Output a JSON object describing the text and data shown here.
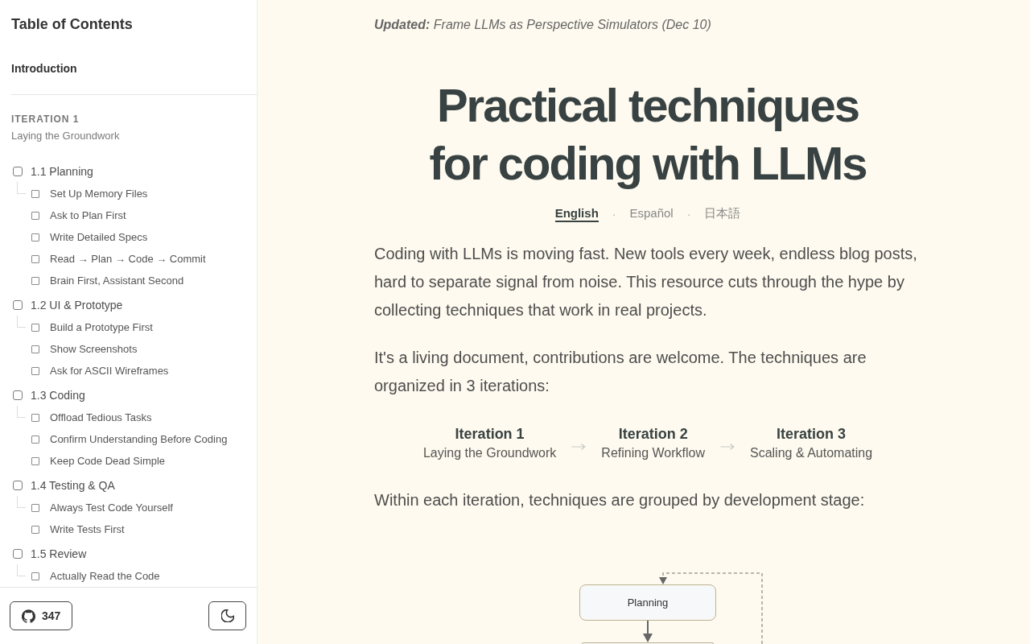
{
  "sidebar": {
    "title": "Table of Contents",
    "intro": {
      "label": "Introduction"
    },
    "iterations": [
      {
        "heading": "ITERATION 1",
        "subtitle": "Laying the Groundwork",
        "sections": [
          {
            "label": "1.1 Planning",
            "checked": false,
            "children": [
              {
                "label": "Set Up Memory Files",
                "checked": false
              },
              {
                "label": "Ask to Plan First",
                "checked": false
              },
              {
                "label": "Write Detailed Specs",
                "checked": false
              },
              {
                "label": "Read → Plan → Code → Commit",
                "checked": false
              },
              {
                "label": "Brain First, Assistant Second",
                "checked": false
              }
            ]
          },
          {
            "label": "1.2 UI & Prototype",
            "checked": false,
            "children": [
              {
                "label": "Build a Prototype First",
                "checked": false
              },
              {
                "label": "Show Screenshots",
                "checked": false
              },
              {
                "label": "Ask for ASCII Wireframes",
                "checked": false
              }
            ]
          },
          {
            "label": "1.3 Coding",
            "checked": false,
            "children": [
              {
                "label": "Offload Tedious Tasks",
                "checked": false
              },
              {
                "label": "Confirm Understanding Before Coding",
                "checked": false
              },
              {
                "label": "Keep Code Dead Simple",
                "checked": false
              }
            ]
          },
          {
            "label": "1.4 Testing & QA",
            "checked": false,
            "children": [
              {
                "label": "Always Test Code Yourself",
                "checked": false
              },
              {
                "label": "Write Tests First",
                "checked": false
              }
            ]
          },
          {
            "label": "1.5 Review",
            "checked": false,
            "children": [
              {
                "label": "Actually Read the Code",
                "checked": false
              }
            ]
          }
        ]
      }
    ],
    "footer": {
      "github_stars": "347"
    }
  },
  "main": {
    "updated": "**Updated:** Frame LLMs as Perspective Simulators (Dec 10)",
    "title_lines": [
      "Practical techniques",
      "for coding with LLMs"
    ],
    "languages": [
      {
        "kind": "link",
        "label": "English",
        "selected": true
      },
      {
        "kind": "separator",
        "label": "·"
      },
      {
        "kind": "link",
        "label": "Español",
        "selected": false
      },
      {
        "kind": "separator",
        "label": "·"
      },
      {
        "kind": "link",
        "label": "日本語",
        "selected": false
      }
    ],
    "paragraphs_before": [
      "Coding with LLMs is moving fast. New tools every week, endless blog posts, hard to separate signal from noise. This resource cuts through the hype by collecting techniques that work in real projects.",
      "It's a living document, contributions are welcome. The techniques are organized in 3 iterations:"
    ],
    "iterations": [
      {
        "title": "Iteration 1",
        "subtitle": "Laying the Groundwork"
      },
      {
        "title": "Iteration 2",
        "subtitle": "Refining Workflow"
      },
      {
        "title": "Iteration 3",
        "subtitle": "Scaling & Automating"
      }
    ],
    "paragraphs_after": [
      "Within each iteration, techniques are grouped by development stage:"
    ],
    "flowchart": {
      "nodes": [
        {
          "label": "Planning"
        }
      ]
    }
  }
}
